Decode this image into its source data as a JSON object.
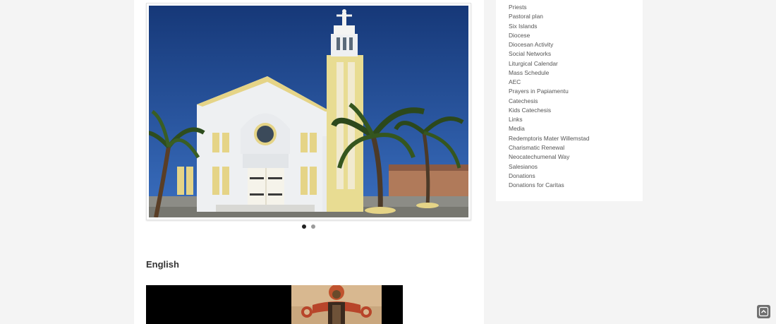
{
  "slider": {
    "image_alt": "White church with yellow bell tower and palm trees",
    "active_slide": 1,
    "dots": [
      "1",
      "2"
    ]
  },
  "main": {
    "section_heading": "English"
  },
  "sidebar": {
    "items": [
      {
        "label": "Priests"
      },
      {
        "label": "Pastoral plan"
      },
      {
        "label": "Six Islands"
      },
      {
        "label": "Diocese"
      },
      {
        "label": "Diocesan Activity"
      },
      {
        "label": "Social Networks"
      },
      {
        "label": "Liturgical Calendar"
      },
      {
        "label": "Mass Schedule"
      },
      {
        "label": "AEC"
      },
      {
        "label": "Prayers in Papiamentu"
      },
      {
        "label": "Catechesis"
      },
      {
        "label": "Kids Catechesis"
      },
      {
        "label": "Links"
      },
      {
        "label": "Media"
      },
      {
        "label": "Redemptoris Mater Willemstad"
      },
      {
        "label": "Charismatic Renewal"
      },
      {
        "label": "Neocatechumenal Way"
      },
      {
        "label": "Salesianos"
      },
      {
        "label": "Donations"
      },
      {
        "label": "Donations for Caritas"
      }
    ]
  },
  "icons": {
    "scroll_top": "chevron-up-icon"
  },
  "colors": {
    "page_bg": "#f4f4f4",
    "panel_bg": "#ffffff",
    "text": "#555555",
    "sky": "#1d3f86",
    "tower_yellow": "#e6d98a"
  }
}
